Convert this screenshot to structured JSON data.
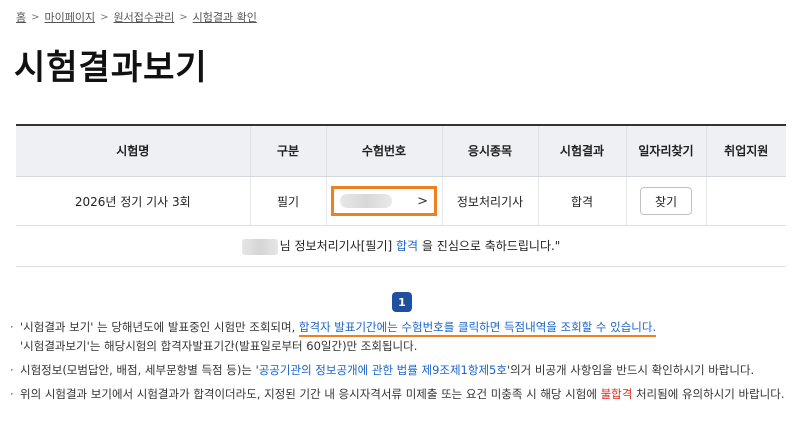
{
  "breadcrumb": {
    "items": [
      "홈",
      "마이페이지",
      "원서접수관리",
      "시험결과 확인"
    ],
    "separator": ">"
  },
  "page_title": "시험결과보기",
  "table": {
    "headers": [
      "시험명",
      "구분",
      "수험번호",
      "응시종목",
      "시험결과",
      "일자리찾기",
      "취업지원"
    ],
    "row": {
      "exam_name": "2026년 정기 기사 3회",
      "category": "필기",
      "exam_number_chevron": ">",
      "subject": "정보처리기사",
      "result": "합격",
      "find_button": "찾기",
      "support": ""
    },
    "congrats": {
      "suffix_1": "님 정보처리기사[필기] ",
      "highlight": "합격",
      "suffix_2": " 을 진심으로 축하드립니다.\""
    }
  },
  "badge": "1",
  "notes": {
    "n1_a": "'시험결과 보기' 는 당해년도에 발표중인 시험만 조회되며, ",
    "n1_link": "합격자 발표기간에는 수험번호를 클릭하면 득점내역을 조회할 수 있습니다.",
    "n1_b": "'시험결과보기'는 해당시험의 합격자발표기간(발표일로부터 60일간)만 조회됩니다.",
    "n2_a": "시험정보(모범답안, 배점, 세부문항별 득점 등)는 '",
    "n2_link": "공공기관의 정보공개에 관한 법률 제9조제1항제5호",
    "n2_b": "'의거 비공개 사항임을 반드시 확인하시기 바랍니다.",
    "n3_a": "위의 시험결과 보기에서 시험결과가 합격이더라도, 지정된 기간 내 응시자격서류 미제출 또는 요건 미충족 시 해당 시험에 ",
    "n3_red": "불합격",
    "n3_b": " 처리됨에 유의하시기 바랍니다."
  },
  "colors": {
    "accent_orange": "#f07e22",
    "link_blue": "#1a64c8",
    "fail_red": "#e1261c",
    "badge_navy": "#1f4f9e",
    "header_bg": "#eef0f4"
  }
}
